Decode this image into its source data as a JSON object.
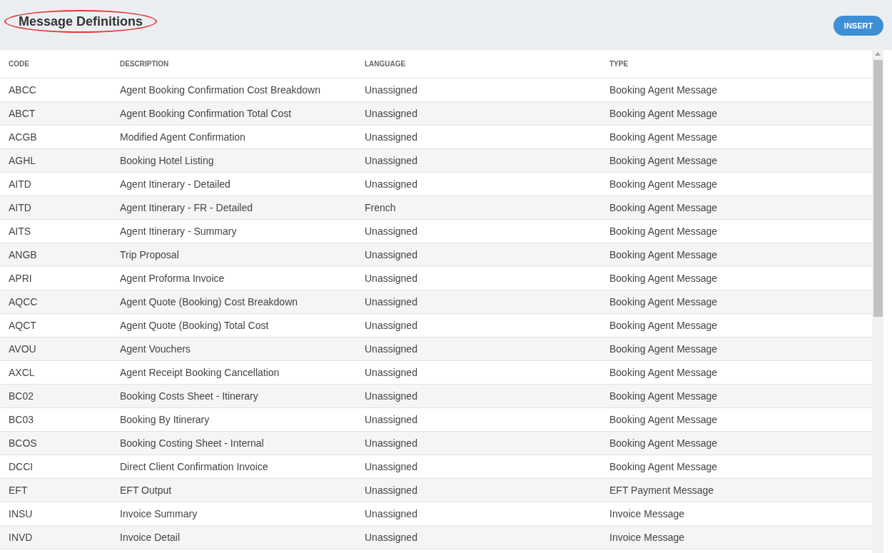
{
  "page": {
    "title": "Message Definitions",
    "insert_button": "INSERT"
  },
  "table": {
    "columns": [
      "CODE",
      "DESCRIPTION",
      "LANGUAGE",
      "TYPE"
    ],
    "rows": [
      [
        "ABCC",
        "Agent Booking Confirmation Cost Breakdown",
        "Unassigned",
        "Booking Agent Message"
      ],
      [
        "ABCT",
        "Agent Booking Confirmation Total Cost",
        "Unassigned",
        "Booking Agent Message"
      ],
      [
        "ACGB",
        "Modified Agent Confirmation",
        "Unassigned",
        "Booking Agent Message"
      ],
      [
        "AGHL",
        "Booking Hotel Listing",
        "Unassigned",
        "Booking Agent Message"
      ],
      [
        "AITD",
        "Agent Itinerary - Detailed",
        "Unassigned",
        "Booking Agent Message"
      ],
      [
        "AITD",
        "Agent Itinerary - FR - Detailed",
        "French",
        "Booking Agent Message"
      ],
      [
        "AITS",
        "Agent Itinerary - Summary",
        "Unassigned",
        "Booking Agent Message"
      ],
      [
        "ANGB",
        "Trip Proposal",
        "Unassigned",
        "Booking Agent Message"
      ],
      [
        "APRI",
        "Agent Proforma Invoice",
        "Unassigned",
        "Booking Agent Message"
      ],
      [
        "AQCC",
        "Agent Quote (Booking) Cost Breakdown",
        "Unassigned",
        "Booking Agent Message"
      ],
      [
        "AQCT",
        "Agent Quote (Booking) Total Cost",
        "Unassigned",
        "Booking Agent Message"
      ],
      [
        "AVOU",
        "Agent Vouchers",
        "Unassigned",
        "Booking Agent Message"
      ],
      [
        "AXCL",
        "Agent Receipt Booking Cancellation",
        "Unassigned",
        "Booking Agent Message"
      ],
      [
        "BC02",
        "Booking Costs Sheet - Itinerary",
        "Unassigned",
        "Booking Agent Message"
      ],
      [
        "BC03",
        "Booking By Itinerary",
        "Unassigned",
        "Booking Agent Message"
      ],
      [
        "BCOS",
        "Booking Costing Sheet - Internal",
        "Unassigned",
        "Booking Agent Message"
      ],
      [
        "DCCI",
        "Direct Client Confirmation Invoice",
        "Unassigned",
        "Booking Agent Message"
      ],
      [
        "EFT",
        "EFT Output",
        "Unassigned",
        "EFT Payment Message"
      ],
      [
        "INSU",
        "Invoice Summary",
        "Unassigned",
        "Invoice Message"
      ],
      [
        "INVD",
        "Invoice Detail",
        "Unassigned",
        "Invoice Message"
      ]
    ]
  }
}
